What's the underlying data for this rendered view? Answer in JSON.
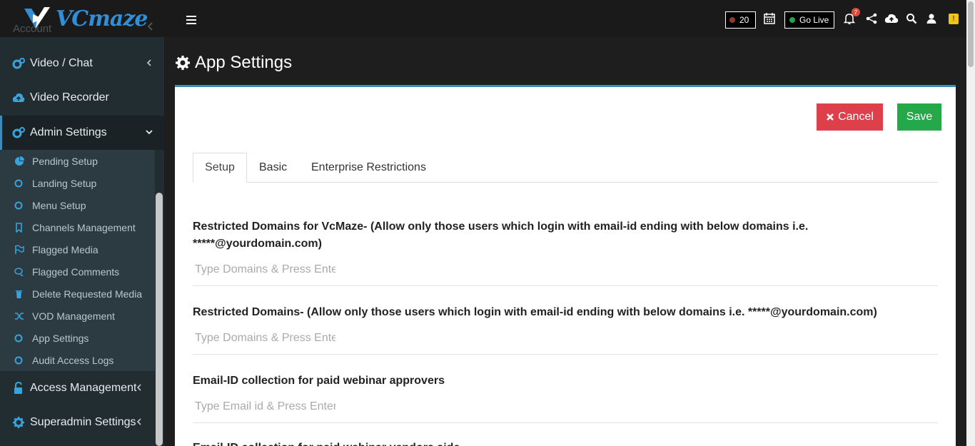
{
  "brand": {
    "name": "VCmaze"
  },
  "sidebar": {
    "ghost_item": "Account",
    "items": [
      {
        "label": "Video / Chat"
      },
      {
        "label": "Video Recorder"
      },
      {
        "label": "Admin Settings"
      },
      {
        "label": "Access Management"
      },
      {
        "label": "Superadmin Settings"
      }
    ],
    "submenu": [
      {
        "label": "Pending Setup",
        "icon": "pie-chart-icon"
      },
      {
        "label": "Landing Setup",
        "icon": "circle-icon"
      },
      {
        "label": "Menu Setup",
        "icon": "circle-icon"
      },
      {
        "label": "Channels Management",
        "icon": "bookmark-icon"
      },
      {
        "label": "Flagged Media",
        "icon": "flag-icon"
      },
      {
        "label": "Flagged Comments",
        "icon": "comments-icon"
      },
      {
        "label": "Delete Requested Media",
        "icon": "trash-icon"
      },
      {
        "label": "VOD Management",
        "icon": "shuffle-icon"
      },
      {
        "label": "App Settings",
        "icon": "circle-icon"
      },
      {
        "label": "Audit Access Logs",
        "icon": "circle-icon"
      }
    ]
  },
  "topbar": {
    "count": "20",
    "go_live": "Go Live",
    "notifications": "7"
  },
  "page": {
    "title": "App Settings",
    "cancel_label": "Cancel",
    "save_label": "Save",
    "tabs": [
      {
        "label": "Setup",
        "active": true
      },
      {
        "label": "Basic",
        "active": false
      },
      {
        "label": "Enterprise Restrictions",
        "active": false
      }
    ],
    "fields": [
      {
        "label": "Restricted Domains for VcMaze- (Allow only those users which login with email-id ending with below domains i.e. *****@yourdomain.com)",
        "placeholder": "Type Domains & Press Enter",
        "value": ""
      },
      {
        "label": "Restricted Domains- (Allow only those users which login with email-id ending with below domains i.e. *****@yourdomain.com)",
        "placeholder": "Type Domains & Press Enter",
        "value": ""
      },
      {
        "label": "Email-ID collection for paid webinar approvers",
        "placeholder": "Type Email id & Press Enter",
        "value": ""
      },
      {
        "label": "Email-ID collection for paid webinar vendors side",
        "placeholder": "",
        "value": ""
      }
    ]
  },
  "colors": {
    "accent": "#3c8dbc",
    "cancel": "#dd3f4b",
    "save": "#24a84a",
    "sidebar_bg": "#222d32",
    "submenu_bg": "#2c3b41",
    "icon_blue": "#3aa3dc"
  }
}
